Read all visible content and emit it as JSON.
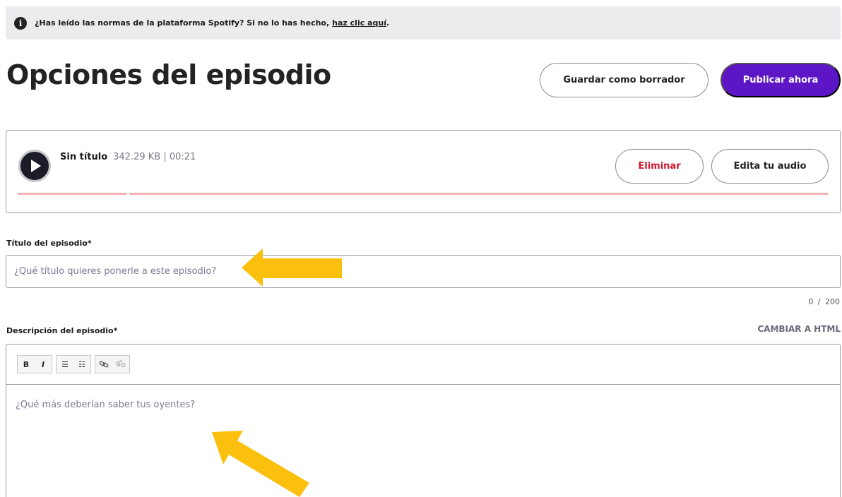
{
  "notice": {
    "text": "¿Has leído las normas de la plataforma Spotify? Si no lo has hecho,",
    "link": "haz clic aquí",
    "suffix": ".",
    "icon": "info-icon"
  },
  "page": {
    "title": "Opciones del episodio"
  },
  "actions": {
    "draft_label": "Guardar como borrador",
    "publish_label": "Publicar ahora"
  },
  "audio": {
    "name": "Sin título",
    "size_duration": "342.29 KB | 00:21",
    "delete_label": "Eliminar",
    "edit_label": "Edita tu audio"
  },
  "title_field": {
    "label": "Título del episodio*",
    "placeholder": "¿Qué título quieres ponerle a este episodio?",
    "counter": "0 / 200"
  },
  "description_field": {
    "label": "Descripción del episodio*",
    "html_toggle": "CAMBIAR A HTML",
    "placeholder": "¿Qué más deberían saber tus oyentes?",
    "toolbar": {
      "bold": "B",
      "italic": "I",
      "bullet_list": "☰",
      "numbered_list": "☷",
      "link_icon": "link-icon",
      "unlink_icon": "unlink-icon"
    }
  },
  "colors": {
    "accent": "#5c16c5",
    "delete": "#d3162f",
    "arrow": "#fbbf0e",
    "progress": "#f2b3b3"
  }
}
